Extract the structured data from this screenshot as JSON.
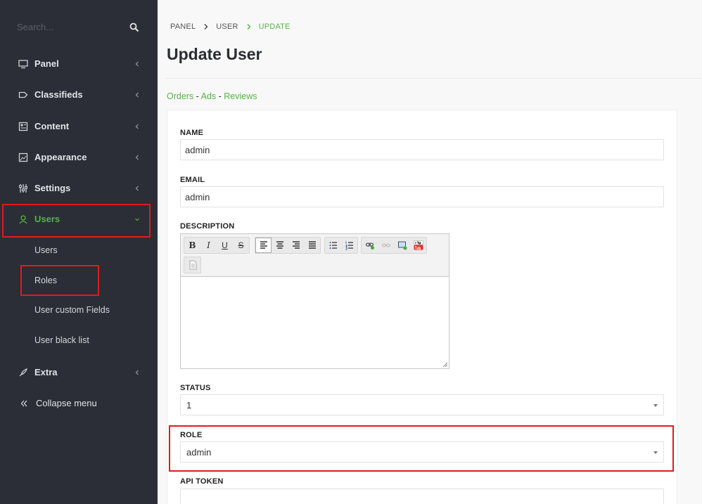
{
  "sidebar": {
    "search_placeholder": "Search...",
    "items": [
      {
        "label": "Panel"
      },
      {
        "label": "Classifieds"
      },
      {
        "label": "Content"
      },
      {
        "label": "Appearance"
      },
      {
        "label": "Settings"
      },
      {
        "label": "Users"
      },
      {
        "label": "Extra"
      }
    ],
    "users_sub": [
      {
        "label": "Users"
      },
      {
        "label": "Roles"
      },
      {
        "label": "User custom Fields"
      },
      {
        "label": "User black list"
      }
    ],
    "collapse_label": "Collapse menu",
    "accent_color": "#53b541",
    "highlight_color": "#e01b1b"
  },
  "breadcrumb": [
    "PANEL",
    "USER",
    "UPDATE"
  ],
  "page_title": "Update User",
  "related_links": {
    "orders": "Orders",
    "ads": "Ads",
    "reviews": "Reviews",
    "separator": " - "
  },
  "form": {
    "name_label": "NAME",
    "name_value": "admin",
    "email_label": "EMAIL",
    "email_value": "admin",
    "description_label": "DESCRIPTION",
    "status_label": "STATUS",
    "status_value": "1",
    "role_label": "ROLE",
    "role_value": "admin",
    "api_token_label": "API TOKEN"
  },
  "editor_toolbar": {
    "bold": "B",
    "italic": "I",
    "underline": "U",
    "strike": "S"
  }
}
